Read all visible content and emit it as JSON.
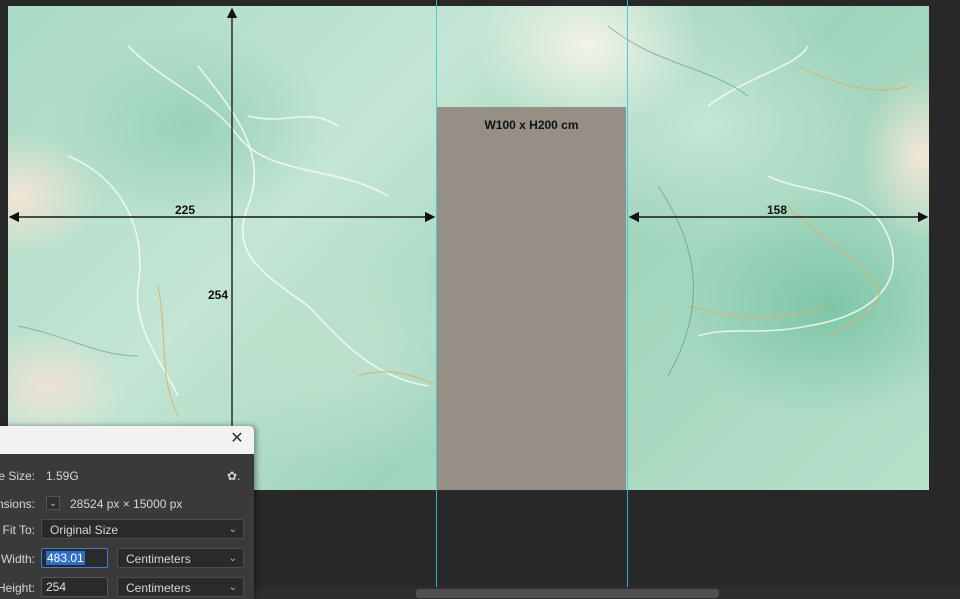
{
  "artboard": {
    "door_label": "W100 x H200 cm",
    "dim_left_width": "225",
    "dim_right_width": "158",
    "dim_height": "254"
  },
  "dialog": {
    "close_glyph": "✕",
    "image_size_label": "e Size:",
    "image_size_value": "1.59G",
    "gear_glyph": "✿.",
    "dimensions_label": "nsions:",
    "dimensions_toggle_glyph": "⌄",
    "dimensions_value": "28524 px  ×  15000 px",
    "fit_to_label": "Fit To:",
    "fit_to_value": "Original Size",
    "width_label": "Width:",
    "width_value": "483.01",
    "width_unit": "Centimeters",
    "height_label": "Height:",
    "height_value": "254",
    "height_unit": "Centimeters"
  },
  "colors": {
    "workspace": "#282828",
    "guide": "#33c7d6",
    "door_panel": "#968f86",
    "dialog_bg": "#3a3a3a",
    "selection": "#2d6fc6"
  },
  "icons": {
    "close": "close-icon",
    "gear": "gear-icon",
    "chevron": "chevron-down-icon"
  }
}
